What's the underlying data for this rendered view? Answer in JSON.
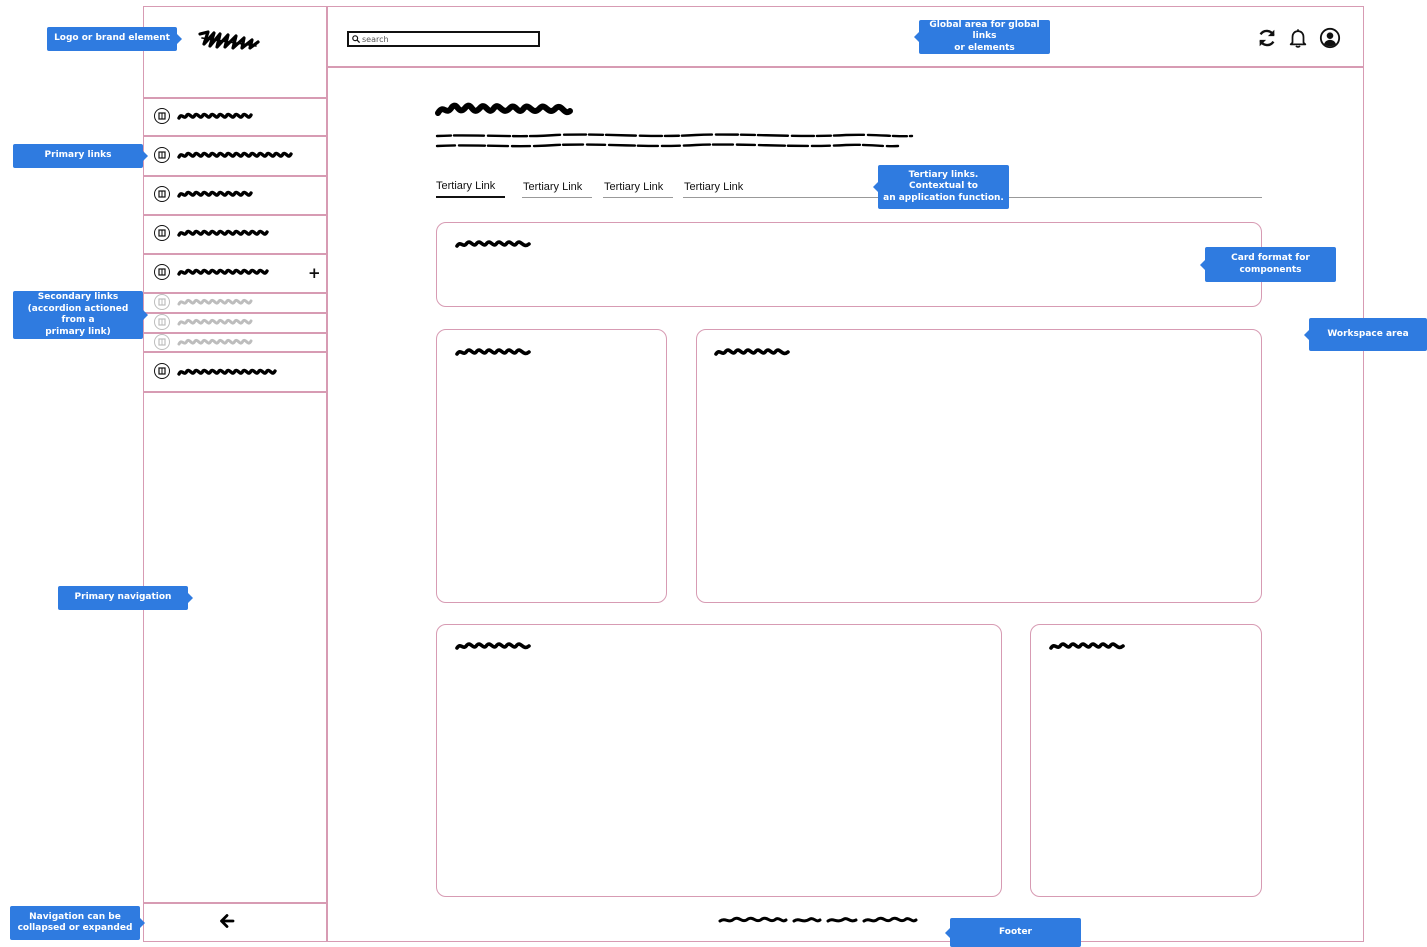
{
  "header": {
    "search_placeholder": "search",
    "icons": [
      "refresh-icon",
      "bell-icon",
      "user-profile-icon"
    ]
  },
  "brand": {
    "logo": "scribbled-logo"
  },
  "sidebar": {
    "primary_items": [
      "item-1",
      "item-2",
      "item-3",
      "item-4",
      "item-5-expandable"
    ],
    "secondary_items": [
      "sub-1",
      "sub-2",
      "sub-3"
    ],
    "last_item": "item-6",
    "expand_symbol": "+",
    "collapse_icon": "arrow-left-icon"
  },
  "tabs": [
    "Tertiary Link",
    "Tertiary Link",
    "Tertiary Link",
    "Tertiary Link"
  ],
  "callouts": {
    "logo": "Logo or brand element",
    "global": "Global area for global links\nor elements",
    "primary_links": "Primary links",
    "secondary_links": "Secondary links\n(accordion actioned from a\nprimary link)",
    "primary_nav": "Primary navigation",
    "collapse": "Navigation can be\ncollapsed or expanded",
    "tertiary": "Tertiary links. Contextual to\nan application function.",
    "card_format": "Card format for\ncomponents",
    "workspace": "Workspace area",
    "footer": "Footer"
  },
  "colors": {
    "frame": "#d79bb3",
    "callout": "#2f7be0",
    "ink": "#111111",
    "secondary_ink": "#bdbdbd"
  }
}
